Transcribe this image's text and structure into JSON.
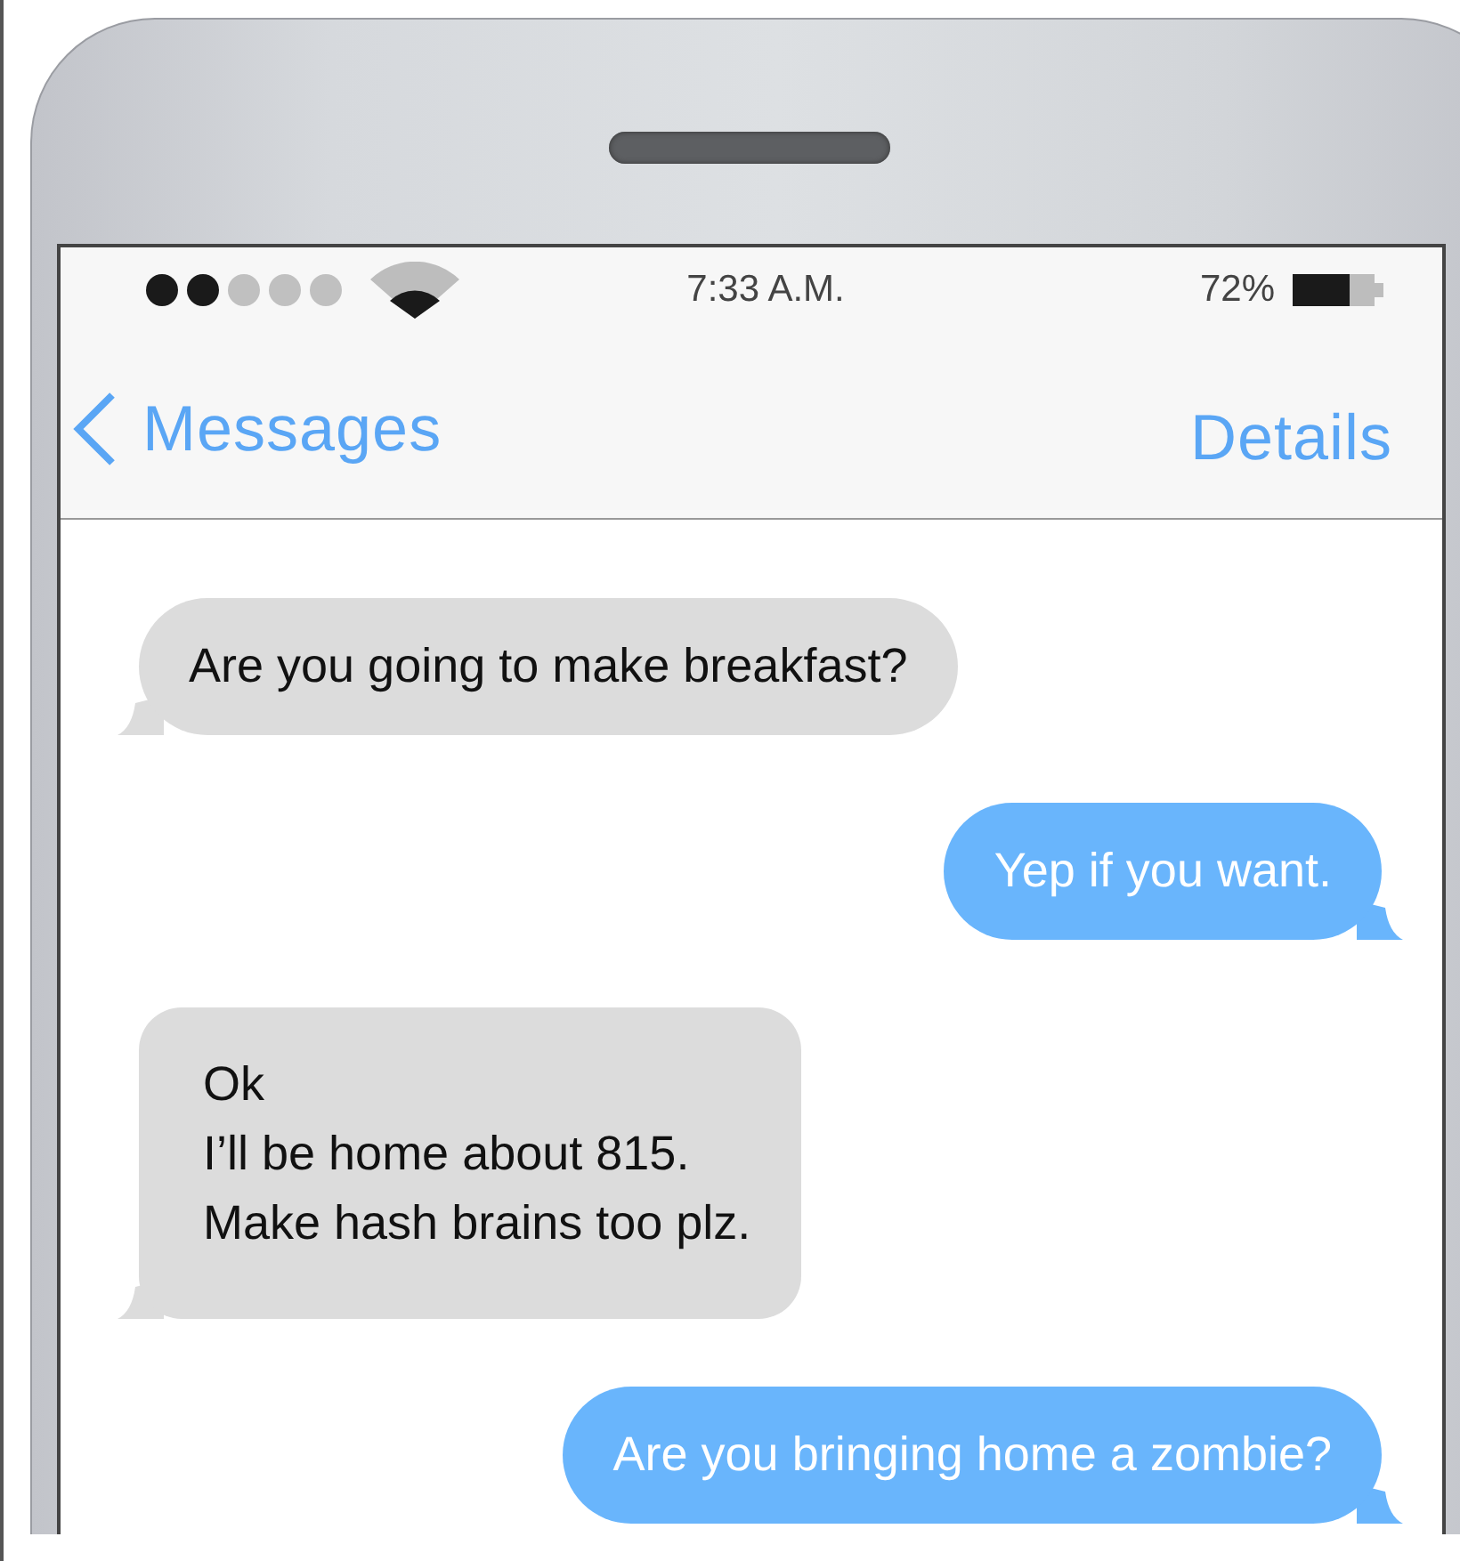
{
  "status_bar": {
    "time": "7:33 A.M.",
    "battery": "72%"
  },
  "nav": {
    "back": "Messages",
    "action": "Details"
  },
  "messages": [
    {
      "outgoing": false,
      "text": "Are you going to make breakfast?"
    },
    {
      "outgoing": true,
      "text": "Yep if you want."
    },
    {
      "outgoing": false,
      "text": "Ok\nI’ll be home about 815.\nMake hash brains too plz."
    },
    {
      "outgoing": true,
      "text": "Are you bringing home a zombie?"
    }
  ]
}
